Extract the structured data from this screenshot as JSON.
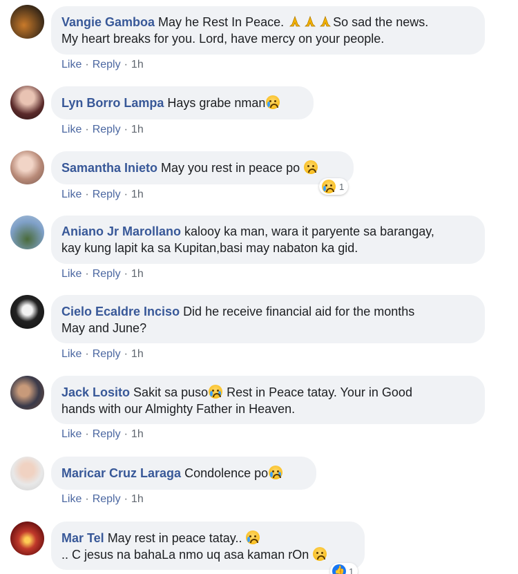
{
  "comments": [
    {
      "author": "Vangie Gamboa",
      "text_a": "May he Rest In Peace. ",
      "text_b": "So sad the news.",
      "text_c": "My heart breaks for you. Lord, have mercy on your people.",
      "like": "Like",
      "reply": "Reply",
      "time": "1h"
    },
    {
      "author": "Lyn Borro Lampa",
      "text": "Hays grabe nman",
      "like": "Like",
      "reply": "Reply",
      "time": "1h"
    },
    {
      "author": "Samantha Inieto",
      "text": "May you rest in peace po ",
      "reaction_count": "1",
      "like": "Like",
      "reply": "Reply",
      "time": "1h"
    },
    {
      "author": "Aniano Jr Marollano",
      "text_a": "kalooy ka man, wara it paryente sa barangay,",
      "text_b": "kay kung lapit ka sa Kupitan,basi may nabaton ka gid.",
      "like": "Like",
      "reply": "Reply",
      "time": "1h"
    },
    {
      "author": "Cielo Ecaldre Inciso",
      "text_a": "Did he receive financial aid for the months",
      "text_b": "May and June?",
      "like": "Like",
      "reply": "Reply",
      "time": "1h"
    },
    {
      "author": "Jack Losito",
      "text_a": "Sakit sa puso",
      "text_b": " Rest in Peace tatay. Your in Good",
      "text_c": "hands with our Almighty Father in Heaven.",
      "like": "Like",
      "reply": "Reply",
      "time": "1h"
    },
    {
      "author": "Maricar Cruz Laraga",
      "text": "Condolence po",
      "like": "Like",
      "reply": "Reply",
      "time": "1h"
    },
    {
      "author": "Mar Tel",
      "text_a": "May rest in peace tatay.. ",
      "text_b": ".. C jesus na bahaLa nmo uq asa kaman rOn ",
      "reaction_count": "1"
    }
  ],
  "separator": "·",
  "colors": {
    "author": "#385898",
    "bubble": "#f0f2f5",
    "action": "#4b67a1",
    "meta": "#606770"
  }
}
